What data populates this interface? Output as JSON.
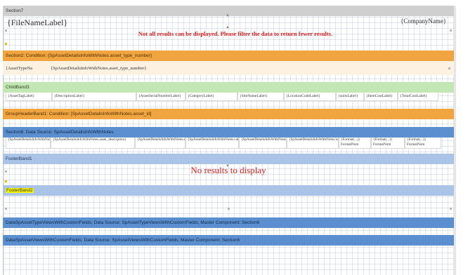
{
  "bands": {
    "section7": "Section7",
    "section2": "Section2: Condition: {SpAssetDetailsInfoWithNotes.asset_type_number}",
    "childband": "ChildBand3",
    "groupheader": "GroupHeaderBand1: Condition: [SpAssetDetailsInfoWithNotes.asset_id]",
    "section6": "Section6: Data Source: SpAssetDetailsInfoWithNotes",
    "footer1": "FooterBand1",
    "footer2": "FooterBand2",
    "data1": "DataSpAssetTypeViewsWithCustomFields; Data Source: SpAssetTypeViewsWithCustomFields; Master Component: Section6",
    "data2": "DataSpAssetViewsWithCustomFields; Data Source: SpAssetViewsWithCustomFields; Master Component: Section6"
  },
  "header": {
    "filename": "{FileNameLabel}",
    "company": "{CompanyName}",
    "warning": "Not all results can be displayed. Please filter the data to return fewer results."
  },
  "section2": {
    "type_label": "{AssetTypeNa",
    "type_value": "{SpAssetDetailsInfoWithNotes.asset_type_number}"
  },
  "child_columns": [
    "{AssetTagLabel}",
    "{DescriptionLabel}",
    "{AssetSerialNumberLabel}",
    "{CategoryLabel}",
    "{SiteNameLabel}",
    "{LocationCodeLabel}",
    "{unitsLabel}",
    "{ItemCostLabel}",
    "{TotalCostLabel}"
  ],
  "detail_columns": [
    "{SpAssetDetailsInfoWithNotes.asset_tag}",
    "{SpAssetDetailsInfoWithNotes.asset_description}",
    "{SpAssetDetailsInfoWithNotes.serial_no}",
    "{SpAssetDetailsInfoWithNotes.category}",
    "{SpAssetDetailsInfoWithNotes.site}",
    "{SpAssetDetailsInfoWithNotes.location}",
    "{Format(...)} FormatNum",
    "{Format(...)} FormatNum",
    "{Format(...)} FormatNum"
  ],
  "footer1": {
    "no_results": "No results to display"
  },
  "colors": {
    "gray_band": "#cfcfcf",
    "orange_band": "#f0a540",
    "green_band": "#c3e6b5",
    "blue_band": "#5b8fcf",
    "lightblue_band": "#a9c4e6",
    "warning_red": "#e02020",
    "highlight": "#f3f300"
  }
}
